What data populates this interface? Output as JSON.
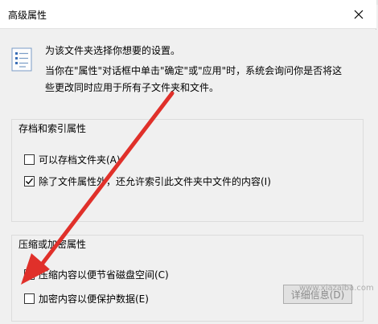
{
  "dialog": {
    "title": "高级属性",
    "intro_line1": "为该文件夹选择你想要的设置。",
    "intro_line2": "当你在\"属性\"对话框中单击\"确定\"或\"应用\"时，系统会询问你是否将这",
    "intro_line3": "些更改同时应用于所有子文件夹和文件。"
  },
  "archive_group": {
    "title": "存档和索引属性",
    "options": [
      {
        "label": "可以存档文件夹(A)",
        "checked": false
      },
      {
        "label": "除了文件属性外，还允许索引此文件夹中文件的内容(I)",
        "checked": true
      }
    ]
  },
  "compress_group": {
    "title": "压缩或加密属性",
    "options": [
      {
        "label": "压缩内容以便节省磁盘空间(C)",
        "checked": true
      },
      {
        "label": "加密内容以便保护数据(E)",
        "checked": false
      }
    ],
    "details_label": "详细信息(D)"
  },
  "watermark": "www.xiazaiba.com",
  "colors": {
    "arrow": "#e0302a"
  },
  "icons": {
    "close": "close-icon",
    "properties": "checklist-icon",
    "checkmark": "checkmark-icon"
  }
}
